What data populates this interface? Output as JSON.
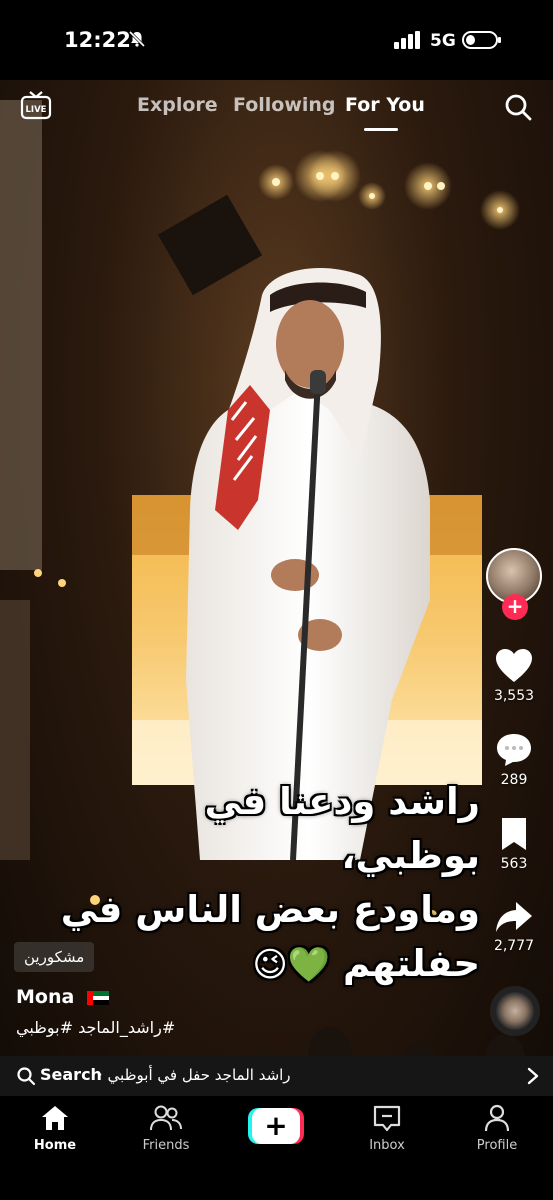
{
  "status_bar": {
    "time": "12:22",
    "network": "5G"
  },
  "top_nav": {
    "live_label": "LIVE",
    "tabs": [
      {
        "label": "Explore",
        "active": false
      },
      {
        "label": "Following",
        "active": false
      },
      {
        "label": "For You",
        "active": true
      }
    ]
  },
  "actions": {
    "likes": "3,553",
    "comments": "289",
    "saves": "563",
    "shares": "2,777"
  },
  "caption": {
    "line1": "راشد ودعنا في بوظبي،",
    "line2": "وماودع بعض الناس في",
    "line3": "حفلتهم",
    "emojis": "💚😉"
  },
  "post": {
    "sticker_tag": "مشكورين",
    "username": "Mona",
    "hashtags": "#راشد_الماجد #بوظبي"
  },
  "search_bar": {
    "label": "Search",
    "query": "· راشد الماجد حفل في أبوظبي"
  },
  "bottom_nav": {
    "home": "Home",
    "friends": "Friends",
    "inbox": "Inbox",
    "profile": "Profile"
  },
  "colors": {
    "accent_red": "#fe2c55",
    "accent_cyan": "#25f4ee",
    "bar_background": "#161616"
  }
}
